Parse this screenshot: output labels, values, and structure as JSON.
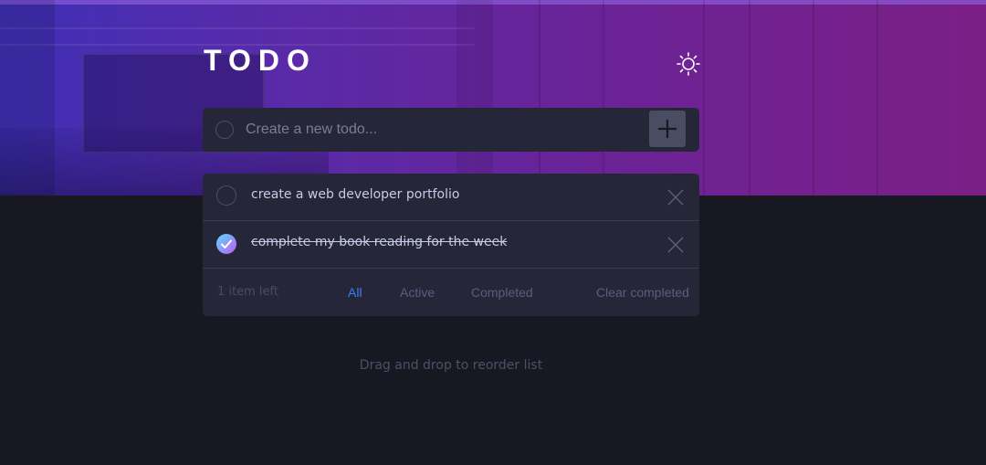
{
  "header": {
    "title": "TODO",
    "theme_toggle_icon": "sun-icon"
  },
  "new_todo": {
    "placeholder": "Create a new todo...",
    "value": "",
    "add_icon": "plus-icon"
  },
  "todos": [
    {
      "text": "create a web developer portfolio",
      "completed": false
    },
    {
      "text": "complete my book reading for the week",
      "completed": true
    }
  ],
  "footer": {
    "items_left": "1 item left",
    "filters": [
      "All",
      "Active",
      "Completed"
    ],
    "active_filter": "All",
    "clear_label": "Clear completed"
  },
  "hint": "Drag and drop to reorder list",
  "colors": {
    "accent": "#3a7cfd",
    "check_gradient_start": "#57ddff",
    "check_gradient_end": "#c058f3",
    "background": "#171821",
    "card": "#252638"
  }
}
